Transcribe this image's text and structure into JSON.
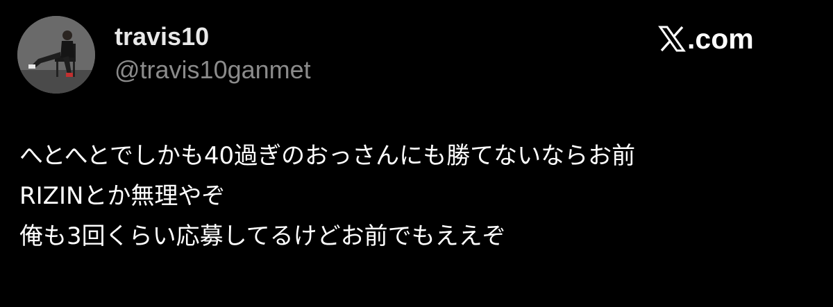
{
  "author": {
    "display_name": "travis10",
    "handle": "@travis10ganmet",
    "avatar_icon": "profile-photo-person-seated-on-chair"
  },
  "brand": {
    "logo_icon": "x-logo-icon",
    "text": ".com"
  },
  "tweet": {
    "lines": [
      "へとへとでしかも40過ぎのおっさんにも勝てないならお前",
      "RIZINとか無理やぞ",
      "俺も3回くらい応募してるけどお前でもええぞ"
    ]
  },
  "colors": {
    "background": "#000000",
    "text_primary": "#ffffff",
    "text_secondary": "#8b8b8b"
  }
}
